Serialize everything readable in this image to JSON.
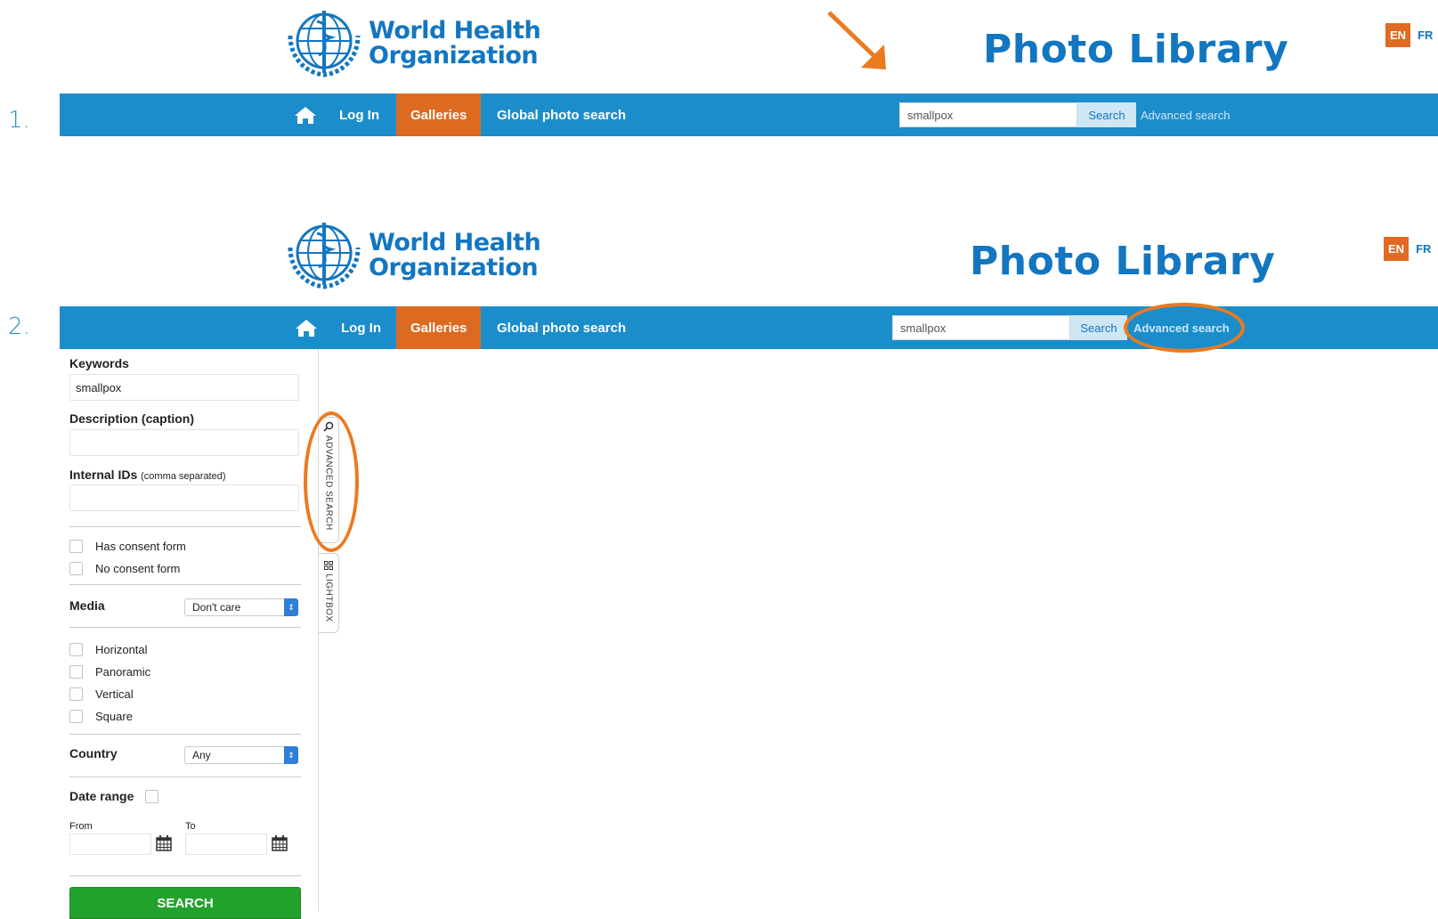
{
  "steps": [
    "1.",
    "2."
  ],
  "header": {
    "logo_line1": "World Health",
    "logo_line2": "Organization",
    "title": "Photo Library",
    "lang_en": "EN",
    "lang_fr": "FR"
  },
  "nav": {
    "home_icon": "home-icon",
    "login": "Log In",
    "galleries": "Galleries",
    "global_search": "Global photo search",
    "search_value": "smallpox",
    "search_button": "Search",
    "advanced_link": "Advanced search"
  },
  "sidebar": {
    "keywords_label": "Keywords",
    "keywords_value": "smallpox",
    "description_label": "Description (caption)",
    "internal_ids_label": "Internal IDs",
    "internal_ids_hint": "(comma separated)",
    "consent_options": [
      "Has consent form",
      "No consent form"
    ],
    "media_label": "Media",
    "media_value": "Don't care",
    "orientation_options": [
      "Horizontal",
      "Panoramic",
      "Vertical",
      "Square"
    ],
    "country_label": "Country",
    "country_value": "Any",
    "date_range_label": "Date range",
    "from_label": "From",
    "to_label": "To",
    "search_button": "SEARCH"
  },
  "side_tabs": {
    "advanced_search": "ADVANCED SEARCH",
    "lightbox": "LIGHTBOX"
  },
  "colors": {
    "brand_blue": "#1c8dcb",
    "accent_orange": "#dd6a21",
    "highlight_ring": "#ec7a1f",
    "search_green": "#23a12d"
  }
}
